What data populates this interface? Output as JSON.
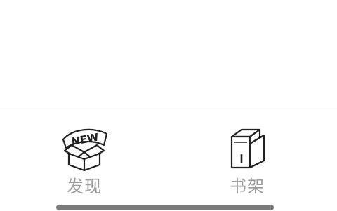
{
  "tabs": [
    {
      "label": "发现",
      "icon": "new-box-icon"
    },
    {
      "label": "书架",
      "icon": "books-icon"
    }
  ],
  "colors": {
    "label": "#9b9b9b",
    "icon_stroke": "#222222",
    "divider": "#e6e6e6",
    "home_indicator": "#7a7a7a"
  }
}
